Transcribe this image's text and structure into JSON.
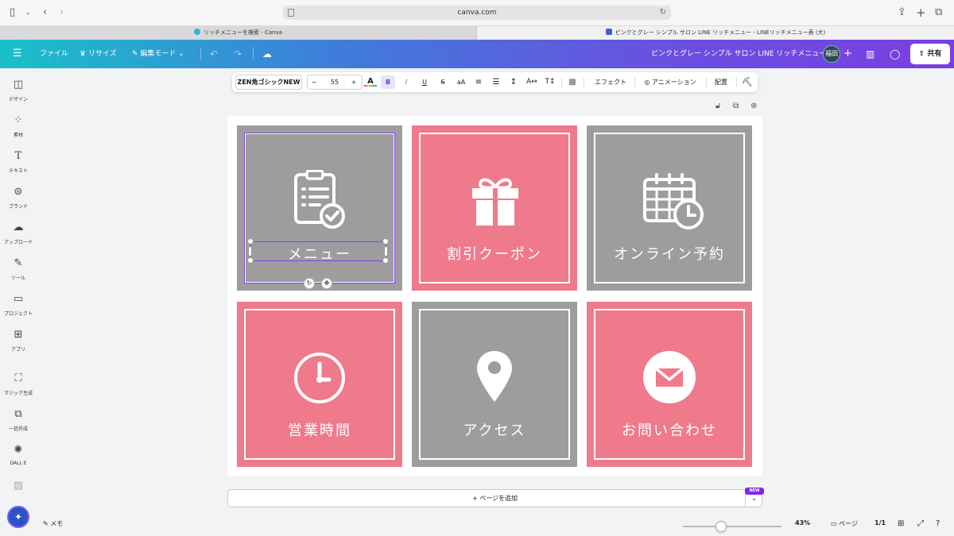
{
  "browser": {
    "url": "canva.com",
    "tabs": [
      {
        "title": "リッチメニューを検索 - Canva"
      },
      {
        "title": "ピンクとグレー シンプル サロン LINE リッチメニュー - LINEリッチメニュー表 (大)"
      }
    ]
  },
  "header": {
    "file_label": "ファイル",
    "resize_label": "リサイズ",
    "edit_mode_label": "編集モード",
    "design_title": "ピンクとグレー シンプル サロン LINE リッチメニュー",
    "avatar_label": "福田",
    "share_label": "共有",
    "colors": {
      "gradient_start": "#19c1c9",
      "gradient_end": "#7a3fe0"
    }
  },
  "sidebar": {
    "items": [
      {
        "label": "デザイン",
        "icon": "layout-icon"
      },
      {
        "label": "素材",
        "icon": "elements-icon"
      },
      {
        "label": "テキスト",
        "icon": "text-icon"
      },
      {
        "label": "ブランド",
        "icon": "brand-icon"
      },
      {
        "label": "アップロード",
        "icon": "upload-icon"
      },
      {
        "label": "ツール",
        "icon": "draw-icon"
      },
      {
        "label": "プロジェクト",
        "icon": "folder-icon"
      },
      {
        "label": "アプリ",
        "icon": "apps-icon"
      },
      {
        "label": "マジック生成",
        "icon": "magic-media-icon"
      },
      {
        "label": "一括作成",
        "icon": "bulk-create-icon"
      },
      {
        "label": "DALL·E",
        "icon": "dalle-icon"
      }
    ]
  },
  "toolbar": {
    "font_name": "ZEN角ゴシックNEW",
    "font_size": "55",
    "minus": "−",
    "plus": "+",
    "bold": "B",
    "italic": "I",
    "underline": "U",
    "strike": "S",
    "case": "aA",
    "effects_label": "エフェクト",
    "animation_label": "アニメーション",
    "position_label": "配置"
  },
  "tiles": [
    {
      "label": "メニュー",
      "icon": "clipboard-check-icon",
      "color": "#9d9d9d"
    },
    {
      "label": "割引クーポン",
      "icon": "gift-icon",
      "color": "#ee7a8c"
    },
    {
      "label": "オンライン予約",
      "icon": "calendar-clock-icon",
      "color": "#9d9d9d"
    },
    {
      "label": "営業時間",
      "icon": "clock-icon",
      "color": "#ee7a8c"
    },
    {
      "label": "アクセス",
      "icon": "map-pin-icon",
      "color": "#9d9d9d"
    },
    {
      "label": "お問い合わせ",
      "icon": "mail-icon",
      "color": "#ee7a8c"
    }
  ],
  "add_page_label": "+ ページを追加",
  "new_badge": "NEW",
  "bottom_bar": {
    "notes_label": "メモ",
    "zoom": "43%",
    "pages_label": "ページ",
    "page_count": "1/1"
  }
}
